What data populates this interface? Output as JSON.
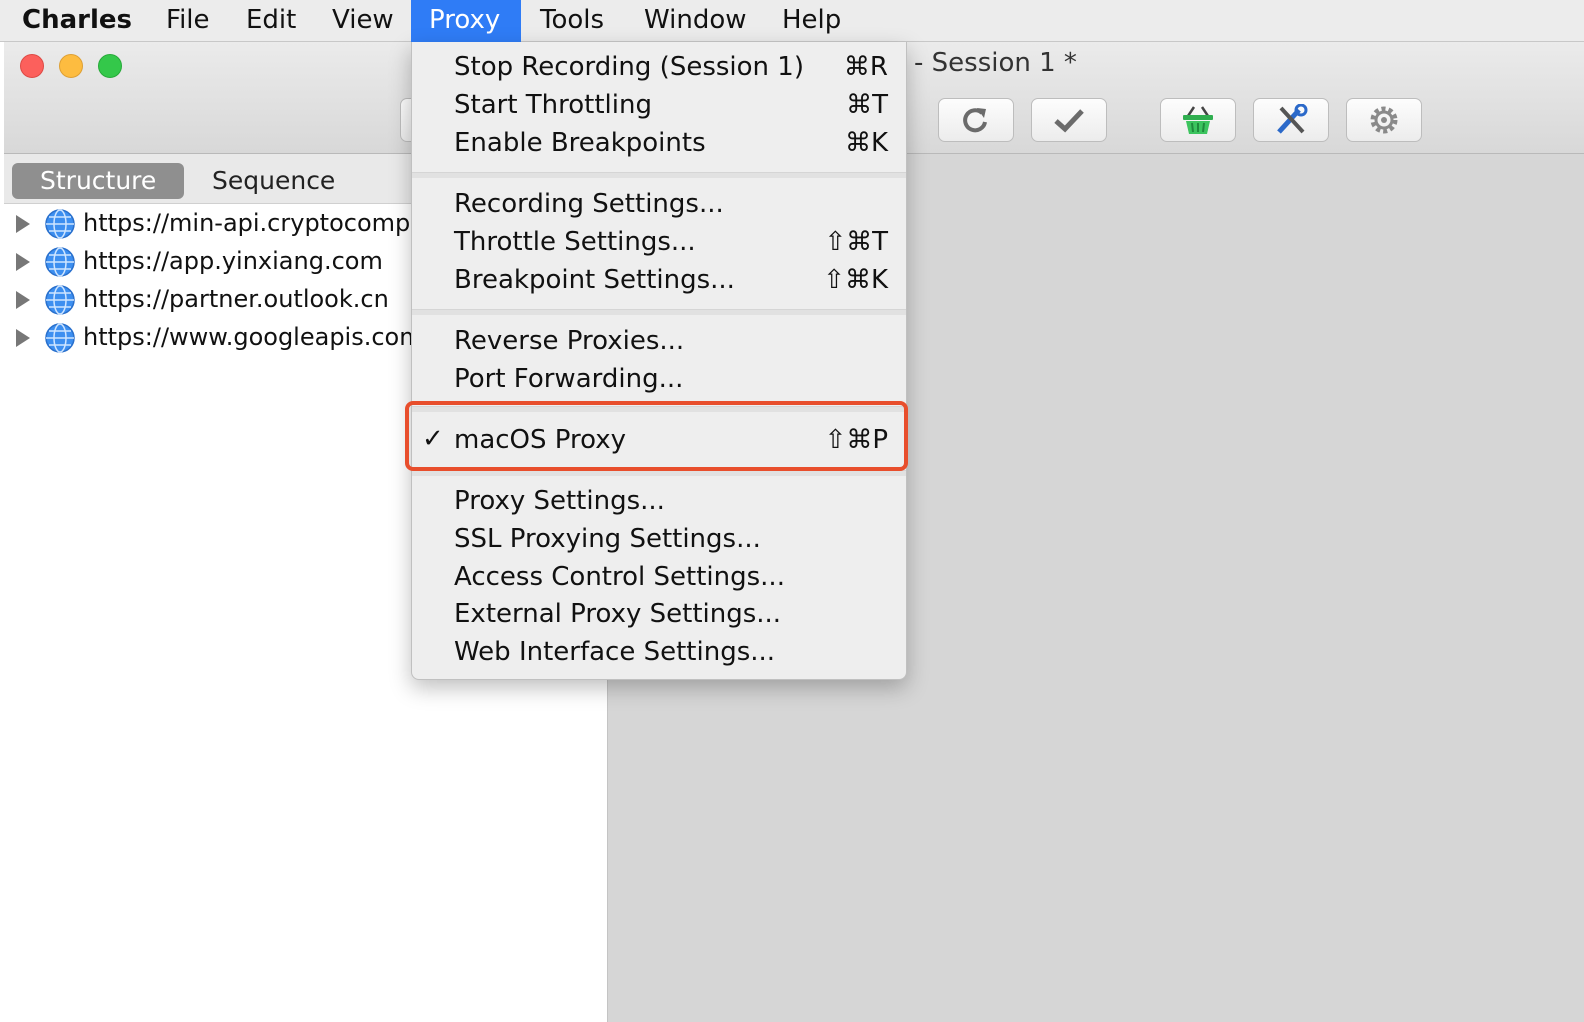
{
  "menubar": {
    "items": [
      {
        "label": "Charles"
      },
      {
        "label": "File"
      },
      {
        "label": "Edit"
      },
      {
        "label": "View"
      },
      {
        "label": "Proxy"
      },
      {
        "label": "Tools"
      },
      {
        "label": "Window"
      },
      {
        "label": "Help"
      }
    ],
    "active_item": "Proxy",
    "active_color": "#2f7cf6"
  },
  "window": {
    "title": "- Session 1 *",
    "toolbar_icons": [
      "refresh-icon",
      "checkmark-icon",
      "basket-icon",
      "tools-icon",
      "gear-icon"
    ]
  },
  "left_pane": {
    "tabs": [
      {
        "label": "Structure",
        "selected": true
      },
      {
        "label": "Sequence",
        "selected": false
      }
    ],
    "hosts": [
      {
        "label": "https://min-api.cryptocompar"
      },
      {
        "label": "https://app.yinxiang.com"
      },
      {
        "label": "https://partner.outlook.cn"
      },
      {
        "label": "https://www.googleapis.com"
      }
    ]
  },
  "proxy_menu": {
    "items": [
      {
        "label": "Stop Recording (Session 1)",
        "shortcut": "⌘R"
      },
      {
        "label": "Start Throttling",
        "shortcut": "⌘T"
      },
      {
        "label": "Enable Breakpoints",
        "shortcut": "⌘K"
      },
      {
        "label": "Recording Settings...",
        "shortcut": ""
      },
      {
        "label": "Throttle Settings...",
        "shortcut": "⇧⌘T"
      },
      {
        "label": "Breakpoint Settings...",
        "shortcut": "⇧⌘K"
      },
      {
        "label": "Reverse Proxies...",
        "shortcut": ""
      },
      {
        "label": "Port Forwarding...",
        "shortcut": ""
      },
      {
        "label": "macOS Proxy",
        "shortcut": "⇧⌘P",
        "checked": true,
        "check_mark": "✓"
      },
      {
        "label": "Proxy Settings...",
        "shortcut": ""
      },
      {
        "label": "SSL Proxying Settings...",
        "shortcut": ""
      },
      {
        "label": "Access Control Settings...",
        "shortcut": ""
      },
      {
        "label": "External Proxy Settings...",
        "shortcut": ""
      },
      {
        "label": "Web Interface Settings...",
        "shortcut": ""
      }
    ],
    "highlight_color": "#e84e2c"
  }
}
